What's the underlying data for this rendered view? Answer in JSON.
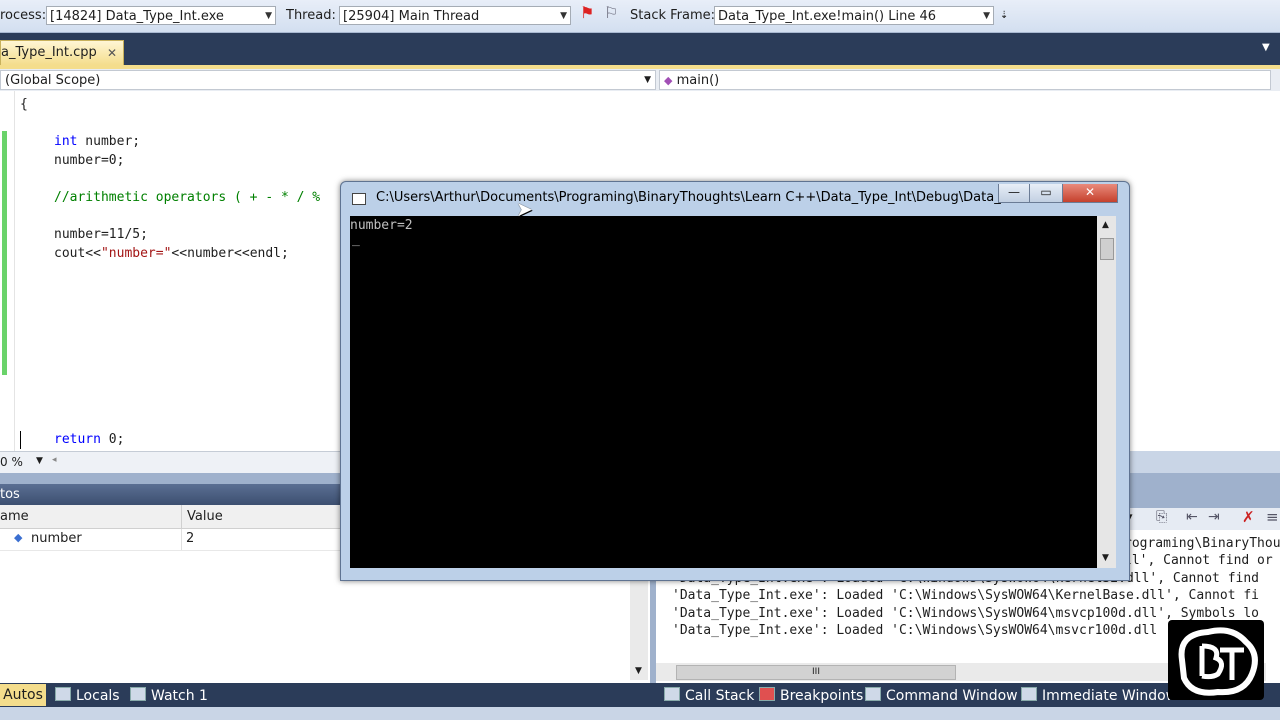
{
  "debug_toolbar": {
    "process_label": "rocess:",
    "process_value": "[14824] Data_Type_Int.exe",
    "thread_label": "Thread:",
    "thread_value": "[25904] Main Thread",
    "stack_label": "Stack Frame:",
    "stack_value": "Data_Type_Int.exe!main()  Line 46"
  },
  "document_tab": {
    "label": "a_Type_Int.cpp",
    "close": "✕"
  },
  "navbar": {
    "scope": "(Global Scope)",
    "member": "main()"
  },
  "editor": {
    "lines": [
      "{",
      "int",
      " number;",
      "number=0;",
      "//arithmetic operators ( + - * / %",
      "number=11/5;",
      "cout<<",
      "\"number=\"",
      "<<number<<endl;",
      "return",
      " 0;"
    ],
    "zoom": "0 %"
  },
  "autos": {
    "title": "tos",
    "col_name": "ame",
    "col_value": "Value",
    "rows": [
      {
        "name": "number",
        "value": "2"
      }
    ]
  },
  "output": {
    "lines": [
      "rograming\\BinaryThou",
      "ll', Cannot find or",
      "'Data_Type_Int.exe': Loaded 'C:\\Windows\\SysWOW64\\kernel32.dll', Cannot find",
      "'Data_Type_Int.exe': Loaded 'C:\\Windows\\SysWOW64\\KernelBase.dll', Cannot fi",
      "'Data_Type_Int.exe': Loaded 'C:\\Windows\\SysWOW64\\msvcp100d.dll', Symbols lo",
      "'Data_Type_Int.exe': Loaded 'C:\\Windows\\SysWOW64\\msvcr100d.dll"
    ],
    "scroll_grip": "III"
  },
  "bottom_tabs": {
    "autos": "Autos",
    "locals": "Locals",
    "watch": "Watch 1",
    "call_stack": "Call Stack",
    "breakpoints": "Breakpoints",
    "command": "Command Window",
    "immediate": "Immediate Window"
  },
  "console": {
    "title": "C:\\Users\\Arthur\\Documents\\Programing\\BinaryThoughts\\Learn C++\\Data_Type_Int\\Debug\\Data_T...",
    "output": "number=2",
    "cursor": "_"
  },
  "colors": {
    "keyword": "#0000ff",
    "comment": "#008000",
    "string": "#a31515",
    "tab_active": "#f4dd8c"
  }
}
